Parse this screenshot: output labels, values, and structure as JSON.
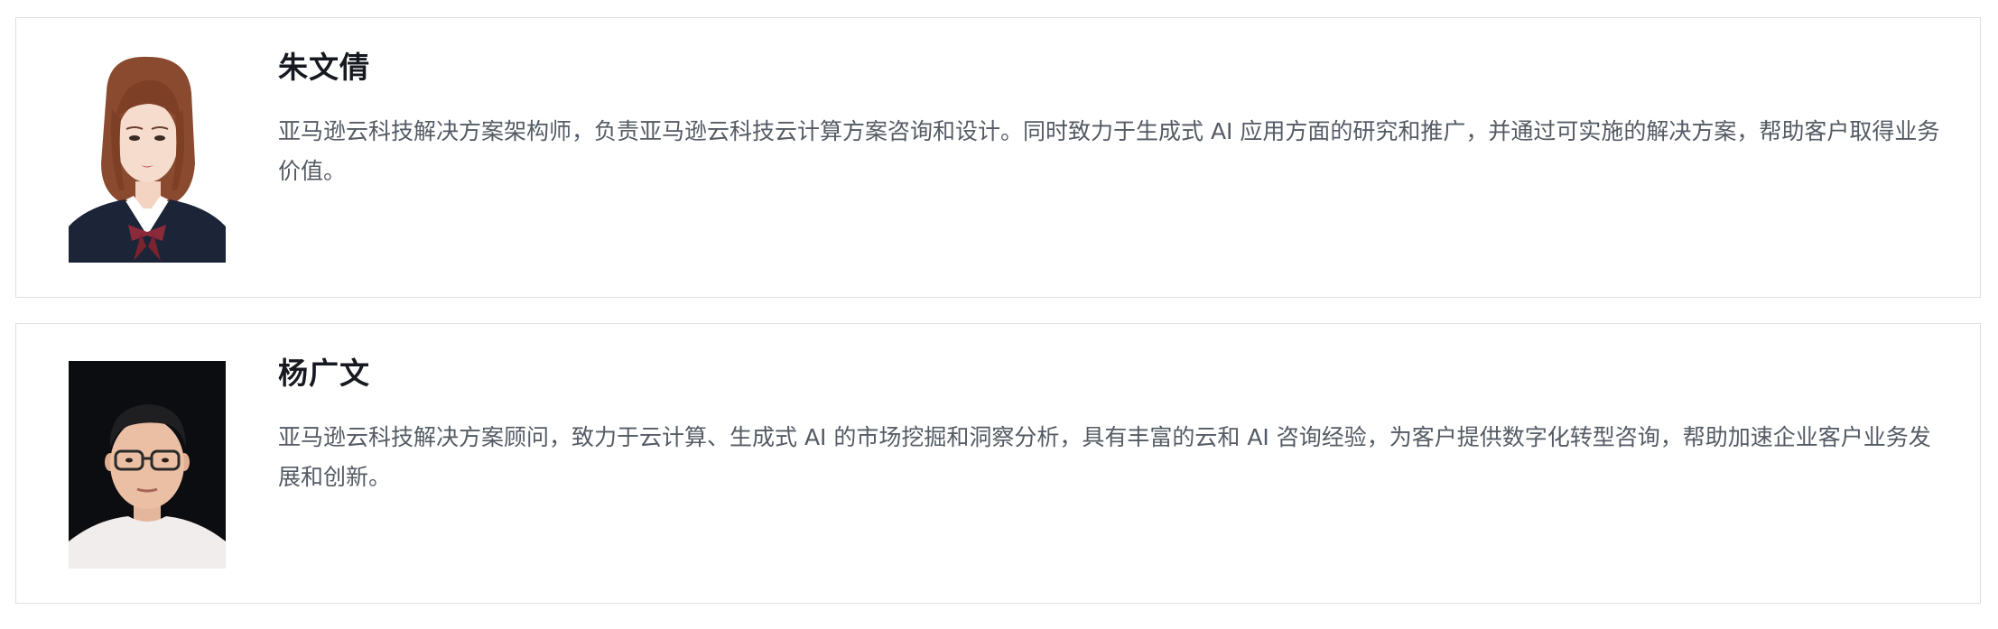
{
  "authors": [
    {
      "name": "朱文倩",
      "bio": "亚马逊云科技解决方案架构师，负责亚马逊云科技云计算方案咨询和设计。同时致力于生成式 AI 应用方面的研究和推广，并通过可实施的解决方案，帮助客户取得业务价值。",
      "avatar_icon": "portrait-photo-female",
      "avatar_background": "#ffffff"
    },
    {
      "name": "杨广文",
      "bio": "亚马逊云科技解决方案顾问，致力于云计算、生成式 AI 的市场挖掘和洞察分析，具有丰富的云和 AI 咨询经验，为客户提供数字化转型咨询，帮助加速企业客户业务发展和创新。",
      "avatar_icon": "portrait-photo-male",
      "avatar_background": "#0b0d10"
    }
  ],
  "colors": {
    "card_border": "#dcdfe3",
    "name_text": "#16191f",
    "bio_text": "#545b64"
  }
}
